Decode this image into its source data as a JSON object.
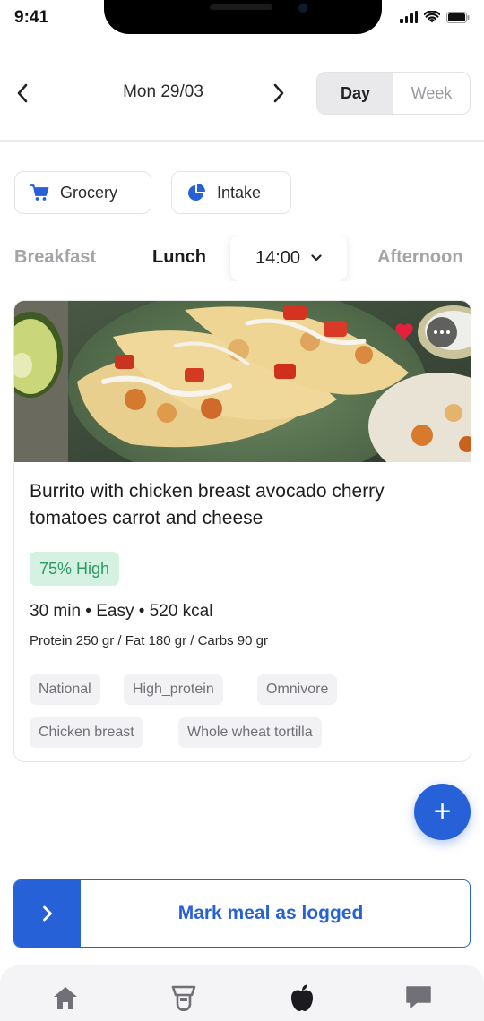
{
  "status_bar": {
    "time": "9:41"
  },
  "header": {
    "date": "Mon 29/03",
    "prev_icon": "chevron-left-icon",
    "next_icon": "chevron-right-icon",
    "view_toggle": {
      "day_label": "Day",
      "week_label": "Week",
      "selected": "Day"
    }
  },
  "actions": {
    "grocery_label": "Grocery",
    "grocery_icon": "cart-icon",
    "intake_label": "Intake",
    "intake_icon": "pie-chart-icon"
  },
  "meal_tabs": {
    "tabs": [
      {
        "label": "Breakfast",
        "active": false
      },
      {
        "label": "Lunch",
        "active": true
      },
      {
        "label": "Afternoon",
        "active": false
      }
    ],
    "time_value": "14:00"
  },
  "recipe": {
    "title": "Burrito with chicken breast avocado cherry tomatoes carrot and cheese",
    "match_badge": "75% High",
    "meta": "30 min • Easy • 520 kcal",
    "macros": "Protein 250 gr / Fat 180 gr / Carbs 90 gr",
    "tags": [
      "National",
      "High_protein",
      "Omnivore",
      "Chicken breast",
      "Whole wheat tortilla"
    ],
    "favorite": true
  },
  "fab": {
    "symbol": "+"
  },
  "mark_logged": {
    "handle_symbol": ">",
    "label": "Mark meal as logged"
  },
  "tab_bar": {
    "items": [
      {
        "icon": "home-icon",
        "active": false
      },
      {
        "icon": "chef-icon",
        "active": false
      },
      {
        "icon": "apple-icon",
        "active": true
      },
      {
        "icon": "chat-icon",
        "active": false
      }
    ]
  },
  "colors": {
    "accent": "#2761d8",
    "badge_bg": "#d5f1e2",
    "badge_text": "#2c9a63",
    "tag_bg": "#f2f2f4",
    "inactive_text": "#a3a3a8"
  }
}
